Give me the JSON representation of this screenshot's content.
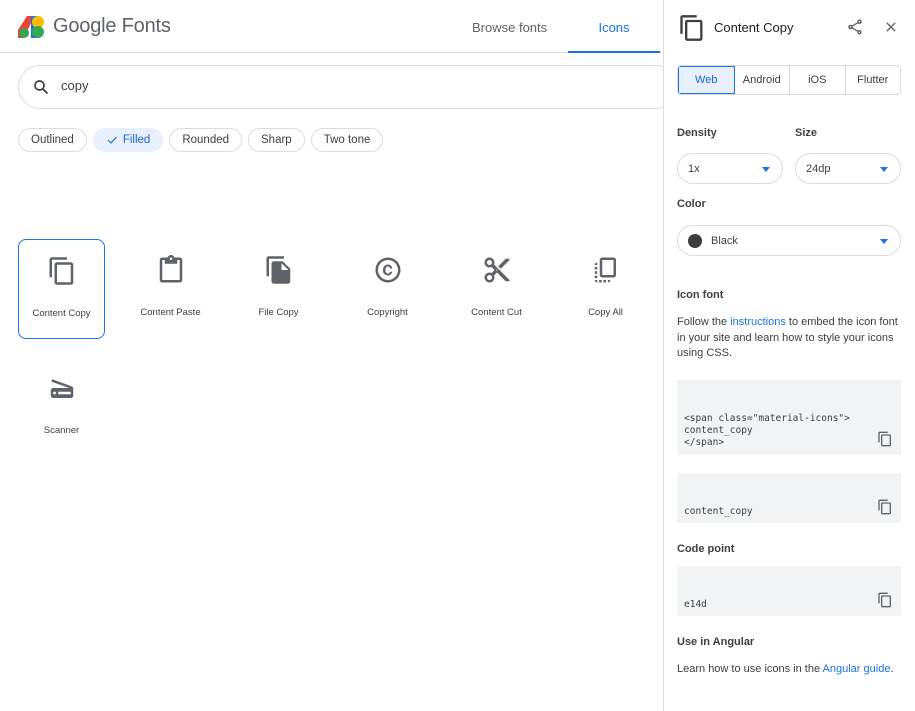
{
  "header": {
    "brand_google": "Google",
    "brand_fonts": "Fonts",
    "nav_browse": "Browse fonts",
    "nav_icons": "Icons",
    "accent": "#1a73e8"
  },
  "search": {
    "value": "copy",
    "icon": "search-icon"
  },
  "chips": [
    {
      "label": "Outlined",
      "active": false
    },
    {
      "label": "Filled",
      "active": true
    },
    {
      "label": "Rounded",
      "active": false
    },
    {
      "label": "Sharp",
      "active": false
    },
    {
      "label": "Two tone",
      "active": false
    }
  ],
  "icons": [
    {
      "label": "Content Copy",
      "icon": "content-copy-icon",
      "selected": true
    },
    {
      "label": "Content Paste",
      "icon": "content-paste-icon"
    },
    {
      "label": "File Copy",
      "icon": "file-copy-icon"
    },
    {
      "label": "Copyright",
      "icon": "copyright-icon"
    },
    {
      "label": "Content Cut",
      "icon": "content-cut-icon"
    },
    {
      "label": "Copy All",
      "icon": "copy-all-icon"
    },
    {
      "label": "Scanner",
      "icon": "scanner-icon"
    }
  ],
  "panel": {
    "title": "Content Copy",
    "platforms": [
      "Web",
      "Android",
      "iOS",
      "Flutter"
    ],
    "active_platform": "Web",
    "density_label": "Density",
    "density_value": "1x",
    "size_label": "Size",
    "size_value": "24dp",
    "color_label": "Color",
    "color_value": "Black",
    "icon_font_heading": "Icon font",
    "icon_font_text_before": "Follow the ",
    "icon_font_link": "instructions",
    "icon_font_text_after": " to embed the icon font in your site and learn how to style your icons using CSS.",
    "code_snippet": "<span class=\"material-icons\">\ncontent_copy\n</span>",
    "ligature": "content_copy",
    "code_point_heading": "Code point",
    "code_point": "e14d",
    "angular_heading": "Use in Angular",
    "angular_text_before": "Learn how to use icons in the ",
    "angular_link": "Angular guide",
    "angular_text_after": "."
  }
}
